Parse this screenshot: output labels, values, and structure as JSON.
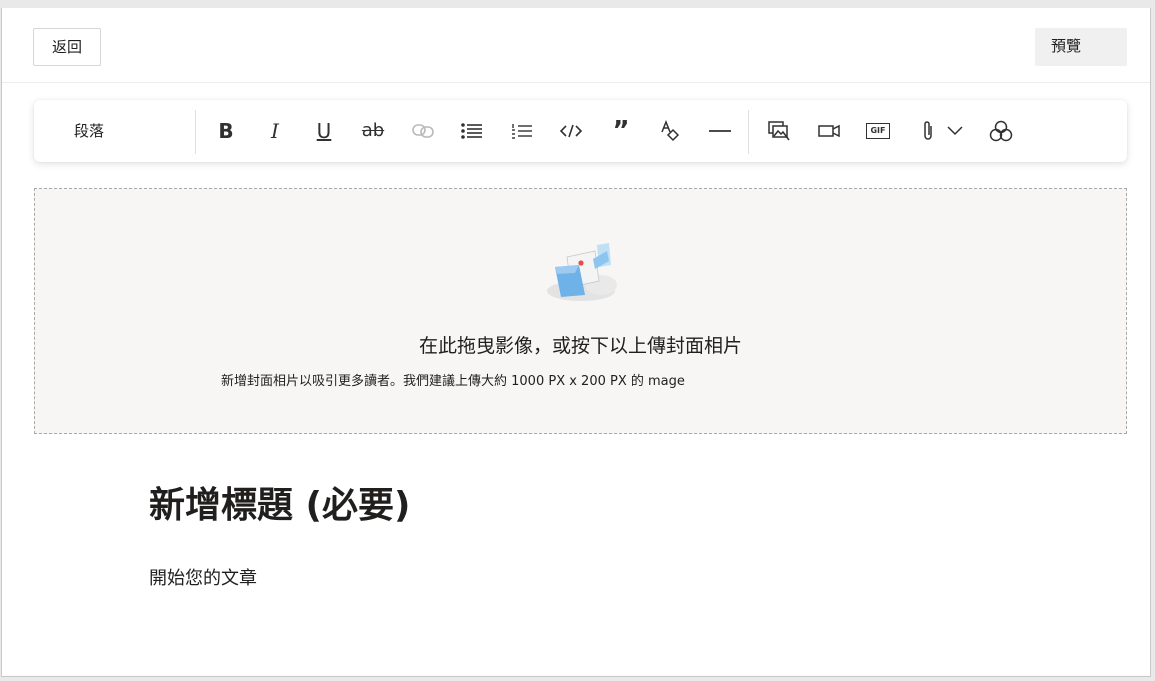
{
  "header": {
    "back_label": "返回",
    "preview_label": "預覽"
  },
  "toolbar": {
    "paragraph_style": "段落",
    "buttons": [
      "bold-icon",
      "italic-icon",
      "underline-icon",
      "strikethrough-icon",
      "link-icon",
      "bulleted-list-icon",
      "numbered-list-icon",
      "code-icon",
      "quote-icon",
      "clear-formatting-icon",
      "horizontal-rule-icon",
      "image-icon",
      "video-icon",
      "gif-icon",
      "attachment-icon",
      "chevron-down-icon",
      "more-options-icon"
    ],
    "bold_glyph": "B",
    "italic_glyph": "I",
    "underline_glyph": "U",
    "strike_glyph": "ab",
    "quote_glyph": "”",
    "gif_glyph": "GIF"
  },
  "cover": {
    "title": "在此拖曳影像，或按下以上傳封面相片",
    "subtitle": "新增封面相片以吸引更多讀者。我們建議上傳大約 1000 PX x 200 PX 的 mage"
  },
  "article": {
    "title_placeholder": "新增標題 (必要)",
    "body_placeholder": "開始您的文章"
  },
  "colors": {
    "accent": "#0078d4",
    "dropzone_bg": "#f7f6f5"
  }
}
